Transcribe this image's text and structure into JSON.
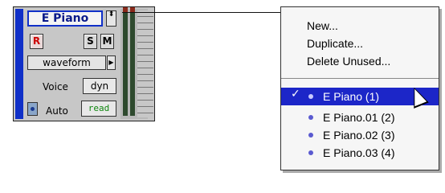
{
  "track": {
    "name": "E Piano",
    "stepper_glyph": "⬍",
    "rec_label": "R",
    "solo_label": "S",
    "mute_label": "M",
    "view_selector": "waveform",
    "view_arrow": "▶",
    "voice_label": "Voice",
    "voice_value": "dyn",
    "auto_label": "Auto",
    "auto_value": "read"
  },
  "menu": {
    "items": [
      "New...",
      "Duplicate...",
      "Delete Unused..."
    ],
    "playlists": [
      {
        "label": "E Piano (1)",
        "selected": true,
        "check": "✓"
      },
      {
        "label": "E Piano.01 (2)",
        "selected": false
      },
      {
        "label": "E Piano.02 (3)",
        "selected": false
      },
      {
        "label": "E Piano.03 (4)",
        "selected": false
      }
    ]
  },
  "colors": {
    "track_color": "#1030c8",
    "selection": "#1c26c8",
    "auto_read": "#118811",
    "record": "#cc0000"
  },
  "icons": [
    "stepper-icon",
    "dropdown-arrow-icon",
    "automation-icon",
    "checkmark-icon",
    "mouse-cursor-icon",
    "playlist-dot-icon"
  ]
}
